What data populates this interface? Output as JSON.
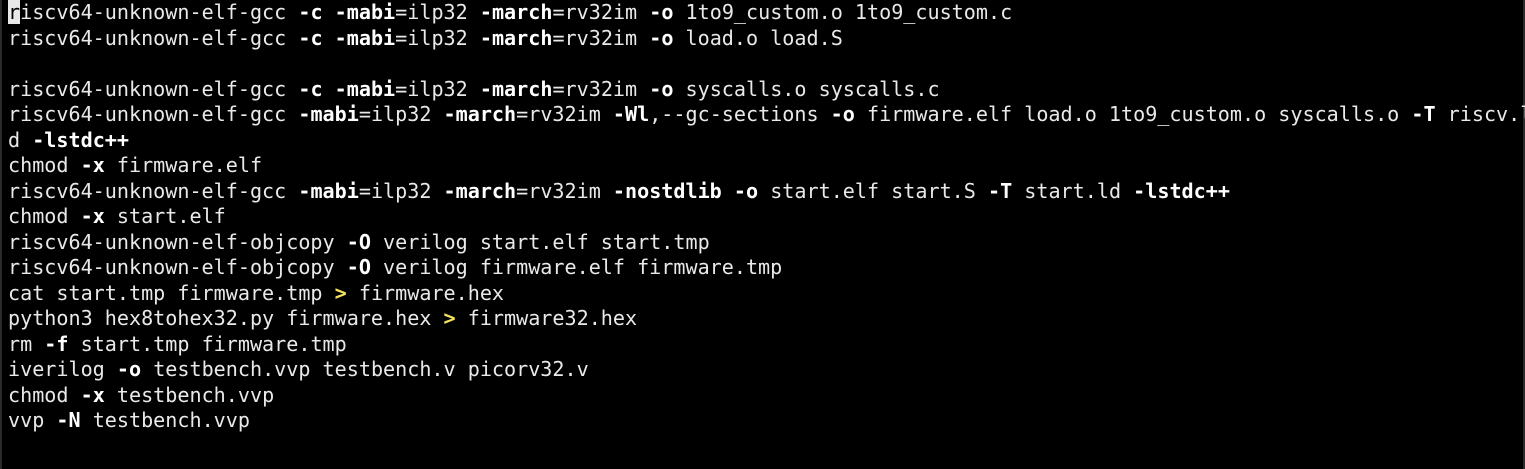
{
  "colors": {
    "background": "#000000",
    "text": "#e9e9e9",
    "flag": "#ffffff",
    "operator": "#f4e35c",
    "cursor": "#e9e9e9"
  },
  "terminal": {
    "lines": [
      [
        [
          "c",
          "r"
        ],
        [
          "t",
          "iscv64-unknown-elf-gcc "
        ],
        [
          "f",
          "-c"
        ],
        [
          "t",
          " "
        ],
        [
          "f",
          "-mabi"
        ],
        [
          "t",
          "=ilp32 "
        ],
        [
          "f",
          "-march"
        ],
        [
          "t",
          "=rv32im "
        ],
        [
          "f",
          "-o"
        ],
        [
          "t",
          " 1to9_custom.o 1to9_custom.c"
        ]
      ],
      [
        [
          "t",
          "riscv64-unknown-elf-gcc "
        ],
        [
          "f",
          "-c"
        ],
        [
          "t",
          " "
        ],
        [
          "f",
          "-mabi"
        ],
        [
          "t",
          "=ilp32 "
        ],
        [
          "f",
          "-march"
        ],
        [
          "t",
          "=rv32im "
        ],
        [
          "f",
          "-o"
        ],
        [
          "t",
          " load.o load.S"
        ]
      ],
      [],
      [
        [
          "t",
          "riscv64-unknown-elf-gcc "
        ],
        [
          "f",
          "-c"
        ],
        [
          "t",
          " "
        ],
        [
          "f",
          "-mabi"
        ],
        [
          "t",
          "=ilp32 "
        ],
        [
          "f",
          "-march"
        ],
        [
          "t",
          "=rv32im "
        ],
        [
          "f",
          "-o"
        ],
        [
          "t",
          " syscalls.o syscalls.c"
        ]
      ],
      [
        [
          "t",
          "riscv64-unknown-elf-gcc "
        ],
        [
          "f",
          "-mabi"
        ],
        [
          "t",
          "=ilp32 "
        ],
        [
          "f",
          "-march"
        ],
        [
          "t",
          "=rv32im "
        ],
        [
          "f",
          "-Wl"
        ],
        [
          "t",
          ",--gc-sections "
        ],
        [
          "f",
          "-o"
        ],
        [
          "t",
          " firmware.elf load.o 1to9_custom.o syscalls.o "
        ],
        [
          "f",
          "-T"
        ],
        [
          "t",
          " riscv.l"
        ]
      ],
      [
        [
          "t",
          "d "
        ],
        [
          "f",
          "-lstdc++"
        ]
      ],
      [
        [
          "t",
          "chmod "
        ],
        [
          "f",
          "-x"
        ],
        [
          "t",
          " firmware.elf"
        ]
      ],
      [
        [
          "t",
          "riscv64-unknown-elf-gcc "
        ],
        [
          "f",
          "-mabi"
        ],
        [
          "t",
          "=ilp32 "
        ],
        [
          "f",
          "-march"
        ],
        [
          "t",
          "=rv32im "
        ],
        [
          "f",
          "-nostdlib"
        ],
        [
          "t",
          " "
        ],
        [
          "f",
          "-o"
        ],
        [
          "t",
          " start.elf start.S "
        ],
        [
          "f",
          "-T"
        ],
        [
          "t",
          " start.ld "
        ],
        [
          "f",
          "-lstdc++"
        ]
      ],
      [
        [
          "t",
          "chmod "
        ],
        [
          "f",
          "-x"
        ],
        [
          "t",
          " start.elf"
        ]
      ],
      [
        [
          "t",
          "riscv64-unknown-elf-objcopy "
        ],
        [
          "f",
          "-O"
        ],
        [
          "t",
          " verilog start.elf start.tmp"
        ]
      ],
      [
        [
          "t",
          "riscv64-unknown-elf-objcopy "
        ],
        [
          "f",
          "-O"
        ],
        [
          "t",
          " verilog firmware.elf firmware.tmp"
        ]
      ],
      [
        [
          "t",
          "cat start.tmp firmware.tmp "
        ],
        [
          "o",
          ">"
        ],
        [
          "t",
          " firmware.hex"
        ]
      ],
      [
        [
          "t",
          "python3 hex8tohex32.py firmware.hex "
        ],
        [
          "o",
          ">"
        ],
        [
          "t",
          " firmware32.hex"
        ]
      ],
      [
        [
          "t",
          "rm "
        ],
        [
          "f",
          "-f"
        ],
        [
          "t",
          " start.tmp firmware.tmp"
        ]
      ],
      [
        [
          "t",
          "iverilog "
        ],
        [
          "f",
          "-o"
        ],
        [
          "t",
          " testbench.vvp testbench.v picorv32.v"
        ]
      ],
      [
        [
          "t",
          "chmod "
        ],
        [
          "f",
          "-x"
        ],
        [
          "t",
          " testbench.vvp"
        ]
      ],
      [
        [
          "t",
          "vvp "
        ],
        [
          "f",
          "-N"
        ],
        [
          "t",
          " testbench.vvp"
        ]
      ]
    ]
  }
}
